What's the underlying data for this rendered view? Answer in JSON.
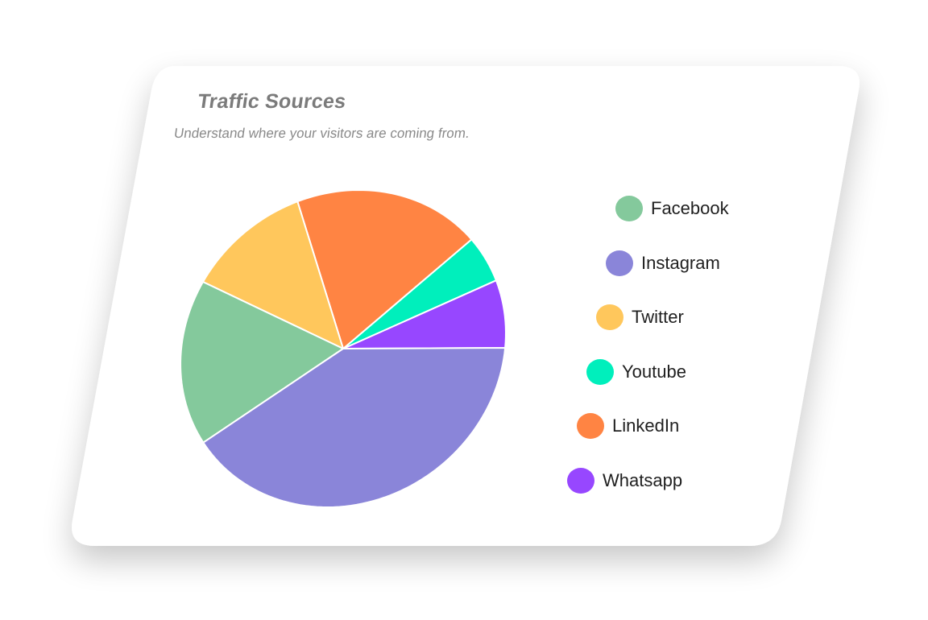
{
  "card": {
    "title": "Traffic Sources",
    "subtitle": "Understand where your visitors are coming from."
  },
  "colors": {
    "card_background": "#ffffff",
    "shadow": "#d9d9d9"
  },
  "chart_data": {
    "type": "pie",
    "title": "Traffic Sources",
    "subtitle": "Understand where your visitors are coming from.",
    "legend_position": "right",
    "slices": [
      {
        "label": "Whatsapp",
        "value": 7,
        "color": "#9747ff"
      },
      {
        "label": "Youtube",
        "value": 5,
        "color": "#00efbc"
      },
      {
        "label": "LinkedIn",
        "value": 19,
        "color": "#ff8443"
      },
      {
        "label": "Twitter",
        "value": 12,
        "color": "#ffc75c"
      },
      {
        "label": "Facebook",
        "value": 17,
        "color": "#84c99c"
      },
      {
        "label": "Instagram",
        "value": 40,
        "color": "#8a85d9"
      }
    ],
    "legend": [
      "Facebook",
      "Instagram",
      "Twitter",
      "Youtube",
      "LinkedIn",
      "Whatsapp"
    ]
  }
}
